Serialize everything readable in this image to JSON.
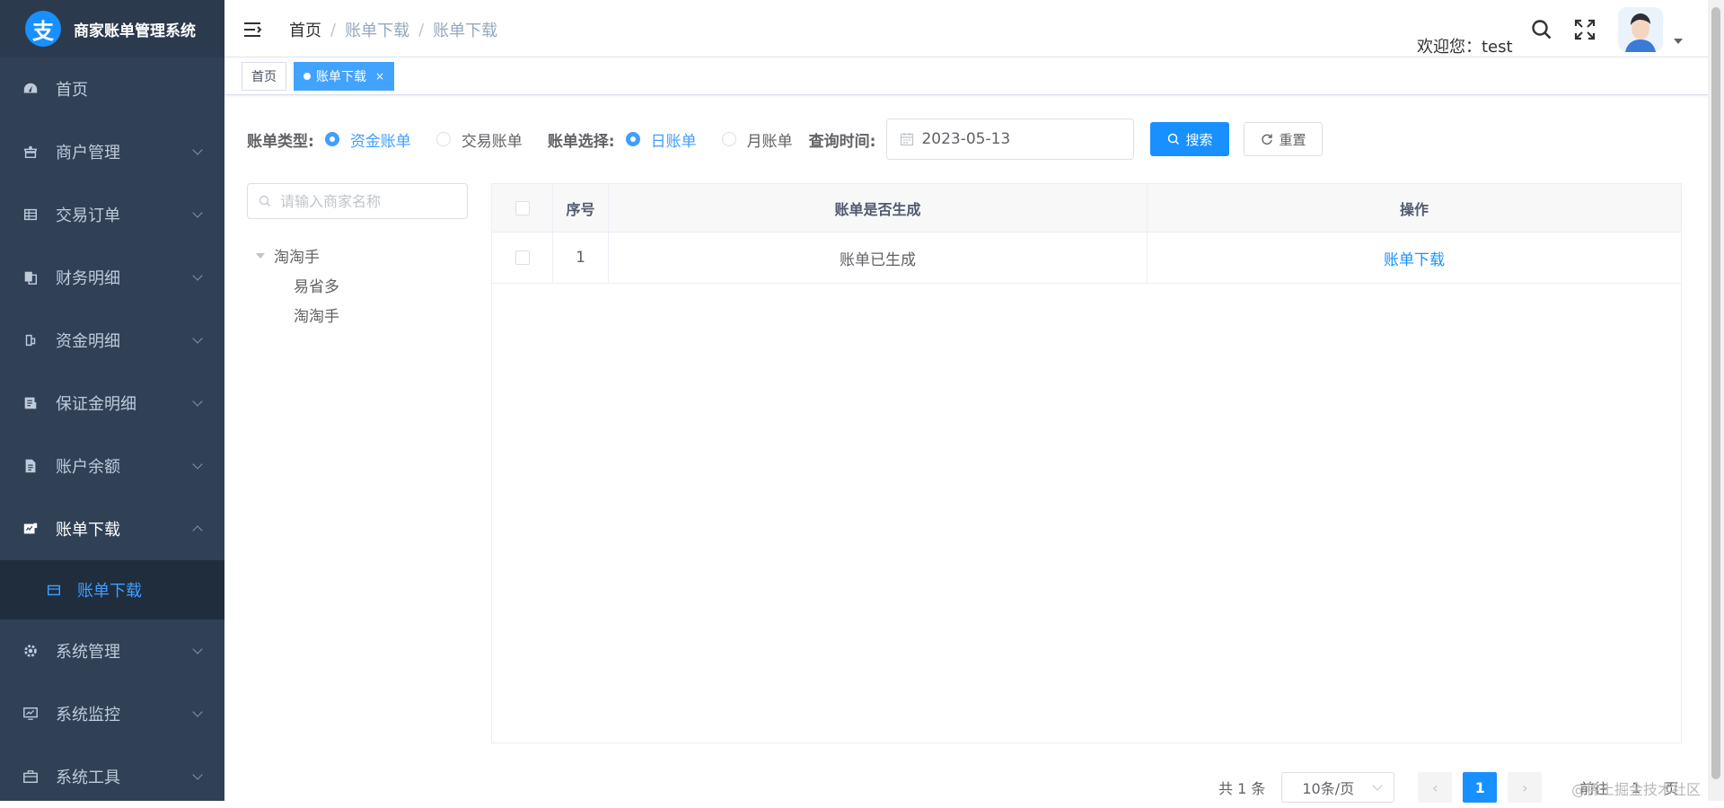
{
  "app": {
    "title": "商家账单管理系统",
    "logo_char": "支"
  },
  "sidebar": {
    "items": [
      {
        "label": "首页",
        "icon": "dashboard-icon",
        "has_children": false
      },
      {
        "label": "商户管理",
        "icon": "merchant-icon",
        "has_children": true
      },
      {
        "label": "交易订单",
        "icon": "table-icon",
        "has_children": true
      },
      {
        "label": "财务明细",
        "icon": "documents-icon",
        "has_children": true
      },
      {
        "label": "资金明细",
        "icon": "money-icon",
        "has_children": true
      },
      {
        "label": "保证金明细",
        "icon": "deposit-icon",
        "has_children": true
      },
      {
        "label": "账户余额",
        "icon": "file-icon",
        "has_children": true
      },
      {
        "label": "账单下载",
        "icon": "download-doc-icon",
        "has_children": true,
        "open": true,
        "children": [
          {
            "label": "账单下载",
            "icon": "calendar-icon",
            "active": true
          }
        ]
      },
      {
        "label": "系统管理",
        "icon": "gear-icon",
        "has_children": true
      },
      {
        "label": "系统监控",
        "icon": "monitor-icon",
        "has_children": true
      },
      {
        "label": "系统工具",
        "icon": "toolbox-icon",
        "has_children": true
      }
    ]
  },
  "header": {
    "breadcrumb": [
      "首页",
      "账单下载",
      "账单下载"
    ],
    "welcome": "欢迎您：test"
  },
  "tags": [
    {
      "label": "首页",
      "active": false
    },
    {
      "label": "账单下载",
      "active": true,
      "close": "×"
    }
  ],
  "filter": {
    "bill_type_label": "账单类型:",
    "bill_type_options": [
      "资金账单",
      "交易账单"
    ],
    "bill_type_selected": "资金账单",
    "bill_period_label": "账单选择:",
    "bill_period_options": [
      "日账单",
      "月账单"
    ],
    "bill_period_selected": "日账单",
    "query_time_label": "查询时间:",
    "query_date": "2023-05-13",
    "search_label": "搜索",
    "reset_label": "重置"
  },
  "tree": {
    "search_placeholder": "请输入商家名称",
    "root": "淘淘手",
    "children": [
      "易省多",
      "淘淘手"
    ]
  },
  "table": {
    "columns": [
      "",
      "序号",
      "账单是否生成",
      "操作"
    ],
    "rows": [
      {
        "index": "1",
        "status": "账单已生成",
        "action": "账单下载"
      }
    ]
  },
  "pagination": {
    "total": "共 1 条",
    "page_size": "10条/页",
    "prev": "‹",
    "current": "1",
    "next": "›",
    "goto_prefix": "前往",
    "goto_value": "1",
    "goto_suffix": "页"
  },
  "watermark": "@稀土掘金技术社区",
  "colors": {
    "sidebar_bg": "#304156",
    "accent": "#1890ff",
    "active_menu": "#409eff"
  }
}
